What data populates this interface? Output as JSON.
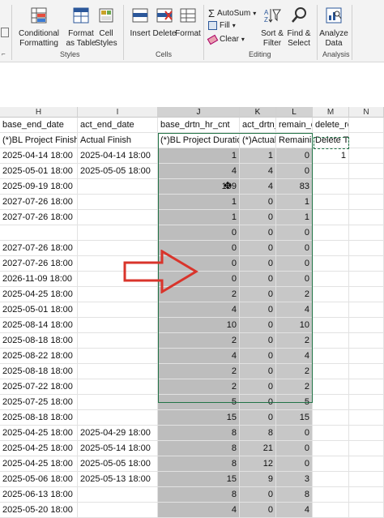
{
  "ribbon": {
    "styles": {
      "conditional_formatting": "Conditional Formatting",
      "format_as_table": "Format as Table",
      "cell_styles": "Cell Styles",
      "group_label": "Styles"
    },
    "cells": {
      "insert": "Insert",
      "delete": "Delete",
      "format": "Format",
      "group_label": "Cells"
    },
    "editing": {
      "autosum": "AutoSum",
      "fill": "Fill",
      "clear": "Clear",
      "sort_filter": "Sort & Filter",
      "find_select": "Find & Select",
      "group_label": "Editing"
    },
    "analysis": {
      "analyze_data": "Analyze Data",
      "group_label": "Analysis"
    }
  },
  "columns": [
    {
      "letter": "H"
    },
    {
      "letter": "I"
    },
    {
      "letter": "J"
    },
    {
      "letter": "K"
    },
    {
      "letter": "L"
    },
    {
      "letter": "M"
    },
    {
      "letter": "N"
    }
  ],
  "header_row": {
    "H": "base_end_date",
    "I": "act_end_date",
    "J": "base_drtn_hr_cnt",
    "K": "act_drtn_hr_cnt",
    "L": "remain_drtn",
    "M": "delete_record_flag"
  },
  "label_row": {
    "H": "(*)BL Project Finish",
    "I": "Actual Finish",
    "J": "(*)BL Project Duration(d",
    "K": "(*)Actual D",
    "L": "Remaining",
    "M": "Delete This Row"
  },
  "rows": [
    {
      "H": "2025-04-14 18:00",
      "I": "2025-04-14 18:00",
      "J": "1",
      "K": "1",
      "L": "0",
      "M": "1"
    },
    {
      "H": "2025-05-01 18:00",
      "I": "2025-05-05 18:00",
      "J": "4",
      "K": "4",
      "L": "0",
      "M": ""
    },
    {
      "H": "2025-09-19 18:00",
      "I": "",
      "J": "109",
      "K": "4",
      "L": "83",
      "M": ""
    },
    {
      "H": "2027-07-26 18:00",
      "I": "",
      "J": "1",
      "K": "0",
      "L": "1",
      "M": ""
    },
    {
      "H": "2027-07-26 18:00",
      "I": "",
      "J": "1",
      "K": "0",
      "L": "1",
      "M": ""
    },
    {
      "H": "",
      "I": "",
      "J": "0",
      "K": "0",
      "L": "0",
      "M": ""
    },
    {
      "H": "2027-07-26 18:00",
      "I": "",
      "J": "0",
      "K": "0",
      "L": "0",
      "M": ""
    },
    {
      "H": "2027-07-26 18:00",
      "I": "",
      "J": "0",
      "K": "0",
      "L": "0",
      "M": ""
    },
    {
      "H": "2026-11-09 18:00",
      "I": "",
      "J": "0",
      "K": "0",
      "L": "0",
      "M": ""
    },
    {
      "H": "2025-04-25 18:00",
      "I": "",
      "J": "2",
      "K": "0",
      "L": "2",
      "M": ""
    },
    {
      "H": "2025-05-01 18:00",
      "I": "",
      "J": "4",
      "K": "0",
      "L": "4",
      "M": ""
    },
    {
      "H": "2025-08-14 18:00",
      "I": "",
      "J": "10",
      "K": "0",
      "L": "10",
      "M": ""
    },
    {
      "H": "2025-08-18 18:00",
      "I": "",
      "J": "2",
      "K": "0",
      "L": "2",
      "M": ""
    },
    {
      "H": "2025-08-22 18:00",
      "I": "",
      "J": "4",
      "K": "0",
      "L": "4",
      "M": ""
    },
    {
      "H": "2025-08-18 18:00",
      "I": "",
      "J": "2",
      "K": "0",
      "L": "2",
      "M": ""
    },
    {
      "H": "2025-07-22 18:00",
      "I": "",
      "J": "2",
      "K": "0",
      "L": "2",
      "M": ""
    },
    {
      "H": "2025-07-25 18:00",
      "I": "",
      "J": "5",
      "K": "0",
      "L": "5",
      "M": ""
    },
    {
      "H": "2025-08-18 18:00",
      "I": "",
      "J": "15",
      "K": "0",
      "L": "15",
      "M": ""
    },
    {
      "H": "2025-04-25 18:00",
      "I": "2025-04-29 18:00",
      "J": "8",
      "K": "8",
      "L": "0",
      "M": ""
    },
    {
      "H": "2025-04-25 18:00",
      "I": "2025-05-14 18:00",
      "J": "8",
      "K": "21",
      "L": "0",
      "M": ""
    },
    {
      "H": "2025-04-25 18:00",
      "I": "2025-05-05 18:00",
      "J": "8",
      "K": "12",
      "L": "0",
      "M": ""
    },
    {
      "H": "2025-05-06 18:00",
      "I": "2025-05-13 18:00",
      "J": "15",
      "K": "9",
      "L": "3",
      "M": ""
    },
    {
      "H": "2025-06-13 18:00",
      "I": "",
      "J": "8",
      "K": "0",
      "L": "8",
      "M": ""
    },
    {
      "H": "2025-05-20 18:00",
      "I": "",
      "J": "4",
      "K": "0",
      "L": "4",
      "M": ""
    }
  ],
  "colors": {
    "selection_fill": "#bdbdbd",
    "selection_border": "#217346",
    "arrow": "#d9342b"
  }
}
